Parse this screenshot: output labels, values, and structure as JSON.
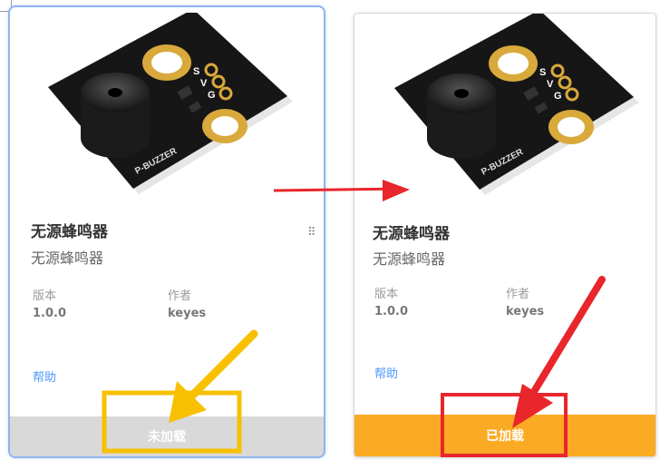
{
  "cards": [
    {
      "title": "无源蜂鸣器",
      "subtitle": "无源蜂鸣器",
      "version_label": "版本",
      "version_value": "1.0.0",
      "author_label": "作者",
      "author_value": "keyes",
      "help_link": "帮助",
      "status_label": "未加载",
      "status_color": "#d9d9d9",
      "pcb_label": "P-BUZZER",
      "pin_labels": [
        "S",
        "V",
        "G"
      ]
    },
    {
      "title": "无源蜂鸣器",
      "subtitle": "无源蜂鸣器",
      "version_label": "版本",
      "version_value": "1.0.0",
      "author_label": "作者",
      "author_value": "keyes",
      "help_link": "帮助",
      "status_label": "已加载",
      "status_color": "#fbaa23",
      "pcb_label": "P-BUZZER",
      "pin_labels": [
        "S",
        "V",
        "G"
      ]
    }
  ],
  "annotations": {
    "arrow_colors": {
      "yellow": "#f7c000",
      "red": "#e8262b"
    },
    "icons": [
      "drag-handle-icon",
      "arrow-right-icon",
      "arrow-yellow-icon",
      "arrow-red-icon"
    ]
  }
}
